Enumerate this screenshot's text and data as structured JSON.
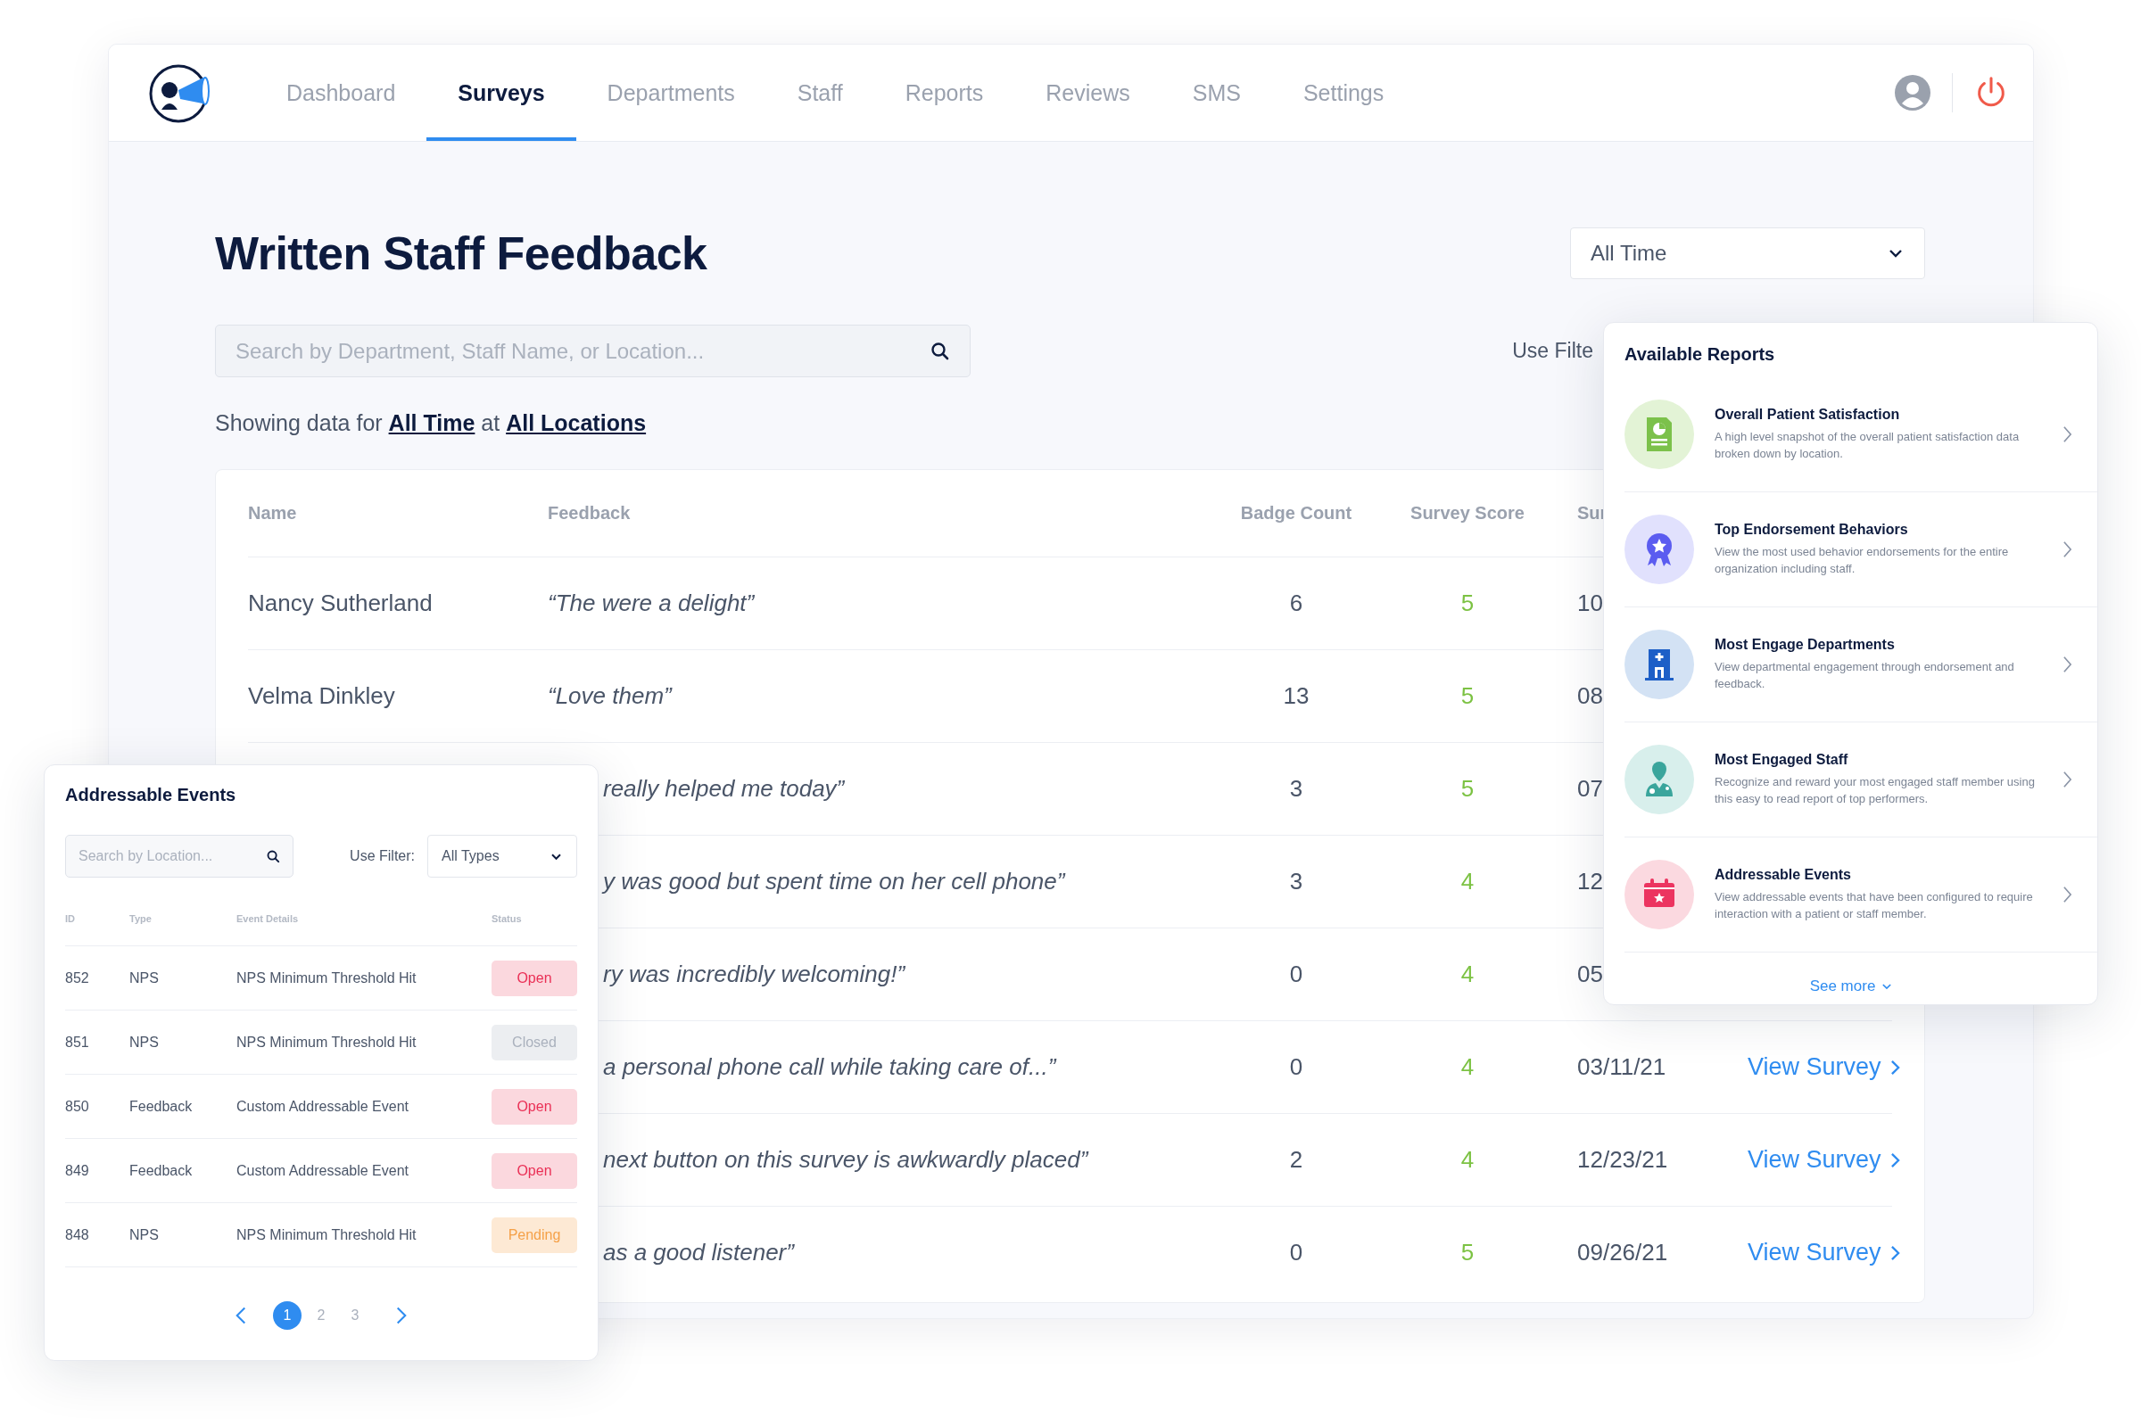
{
  "nav": {
    "tabs": [
      {
        "label": "Dashboard",
        "selected": false
      },
      {
        "label": "Surveys",
        "selected": true
      },
      {
        "label": "Departments",
        "selected": false
      },
      {
        "label": "Staff",
        "selected": false
      },
      {
        "label": "Reports",
        "selected": false
      },
      {
        "label": "Reviews",
        "selected": false
      },
      {
        "label": "SMS",
        "selected": false
      },
      {
        "label": "Settings",
        "selected": false
      }
    ]
  },
  "page": {
    "title": "Written Staff Feedback",
    "period_select": "All Time",
    "search": {
      "placeholder": "Search by Department, Staff Name, or Location..."
    },
    "filter_label": "Use Filte",
    "summary": {
      "prefix": "Showing data for",
      "period": "All Time",
      "joiner": "at",
      "location": "All Locations"
    }
  },
  "table": {
    "columns": [
      "Name",
      "Feedback",
      "Badge Count",
      "Survey Score",
      "Sur"
    ],
    "rows": [
      {
        "name": "Nancy Sutherland",
        "feedback": "“The were a delight”",
        "badge_count": "6",
        "survey_score": "5",
        "date": "10"
      },
      {
        "name": "Velma Dinkley",
        "feedback": "“Love them”",
        "badge_count": "13",
        "survey_score": "5",
        "date": "08"
      },
      {
        "feedback": "really helped me today”",
        "badge_count": "3",
        "survey_score": "5",
        "date": "07"
      },
      {
        "feedback": "y was good but spent time on her cell phone”",
        "badge_count": "3",
        "survey_score": "4",
        "date": "12"
      },
      {
        "feedback": "ry was incredibly welcoming!”",
        "badge_count": "0",
        "survey_score": "4",
        "date": "05"
      },
      {
        "feedback": "a personal phone call while taking care of...”",
        "badge_count": "0",
        "survey_score": "4",
        "date": "03/11/21",
        "action": "View Survey"
      },
      {
        "feedback": "next button on this survey is awkwardly placed”",
        "badge_count": "2",
        "survey_score": "4",
        "date": "12/23/21",
        "action": "View Survey"
      },
      {
        "feedback": "as a good listener”",
        "badge_count": "0",
        "survey_score": "5",
        "date": "09/26/21",
        "action": "View Survey"
      }
    ]
  },
  "events_panel": {
    "title": "Addressable Events",
    "search": {
      "placeholder": "Search by Location..."
    },
    "filter_label": "Use Filter:",
    "filter_value": "All Types",
    "columns": [
      "ID",
      "Type",
      "Event Details",
      "Status"
    ],
    "rows": [
      {
        "id": "852",
        "type": "NPS",
        "details": "NPS Minimum Threshold Hit",
        "status": {
          "label": "Open",
          "kind": "open"
        }
      },
      {
        "id": "851",
        "type": "NPS",
        "details": "NPS Minimum Threshold Hit",
        "status": {
          "label": "Closed",
          "kind": "closed"
        }
      },
      {
        "id": "850",
        "type": "Feedback",
        "details": "Custom Addressable Event",
        "status": {
          "label": "Open",
          "kind": "open"
        }
      },
      {
        "id": "849",
        "type": "Feedback",
        "details": "Custom Addressable Event",
        "status": {
          "label": "Open",
          "kind": "open"
        }
      },
      {
        "id": "848",
        "type": "NPS",
        "details": "NPS Minimum Threshold Hit",
        "status": {
          "label": "Pending",
          "kind": "pending"
        }
      }
    ],
    "pages": [
      {
        "label": "1",
        "selected": true
      },
      {
        "label": "2",
        "selected": false
      },
      {
        "label": "3",
        "selected": false
      }
    ]
  },
  "reports_panel": {
    "title": "Available Reports",
    "items": [
      {
        "kind": "document",
        "title": "Overall Patient Satisfaction",
        "description": "A high level snapshot of the overall patient satisfaction data broken down by location."
      },
      {
        "kind": "award",
        "title": "Top Endorsement Behaviors",
        "description": "View the most used behavior endorsements for the entire organization including staff."
      },
      {
        "kind": "building",
        "title": "Most Engage Departments",
        "description": "View departmental engagement through endorsement and feedback."
      },
      {
        "kind": "doctor",
        "title": "Most Engaged Staff",
        "description": "Recognize and reward your most engaged staff member using this easy to read report of top performers."
      },
      {
        "kind": "calendar",
        "title": "Addressable Events",
        "description": "View addressable events that have been configured to require interaction with a patient or staff member."
      }
    ],
    "see_more": "See more"
  }
}
